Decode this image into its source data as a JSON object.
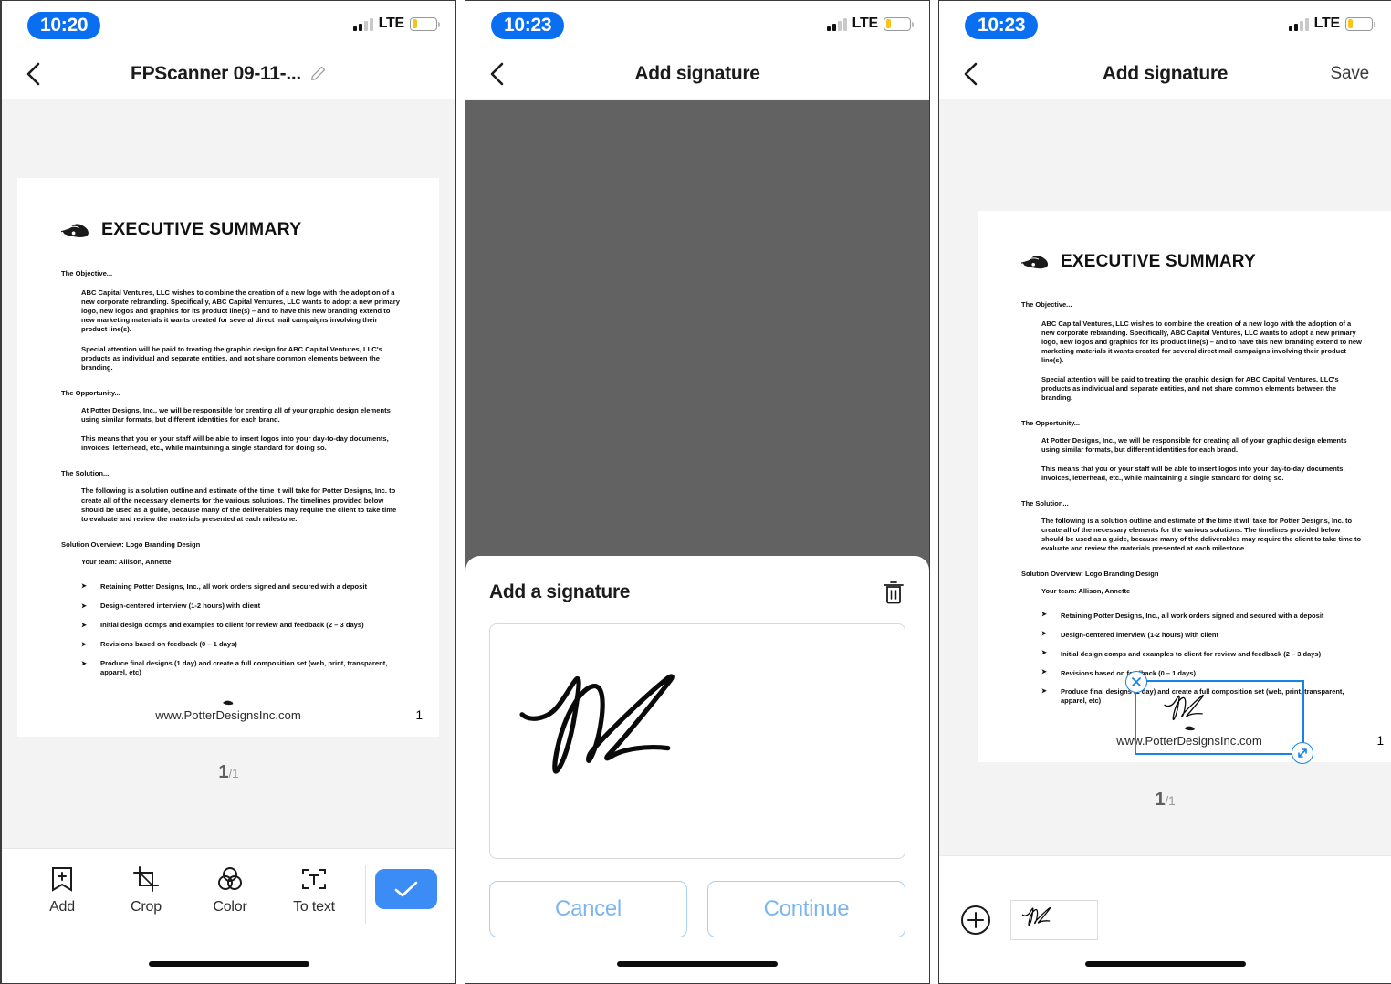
{
  "panels": [
    {
      "status": {
        "time": "10:20",
        "network": "LTE",
        "signal_bars": 2,
        "battery_pct": 22
      },
      "nav": {
        "back_icon": "chevron-left-icon",
        "title": "FPScanner 09-11-...",
        "edit_icon": "pencil-icon"
      },
      "page_indicator": {
        "current": "1",
        "total": "/1"
      },
      "toolbar": {
        "items": [
          {
            "label": "Add",
            "icon": "add-page-icon"
          },
          {
            "label": "Crop",
            "icon": "crop-icon"
          },
          {
            "label": "Color",
            "icon": "color-filter-icon"
          },
          {
            "label": "To text",
            "icon": "to-text-icon"
          }
        ],
        "confirm_icon": "checkmark-icon",
        "confirm_color": "#3b8cf4"
      }
    },
    {
      "status": {
        "time": "10:23",
        "network": "LTE",
        "signal_bars": 2,
        "battery_pct": 22
      },
      "nav": {
        "back_icon": "chevron-left-icon",
        "title": "Add signature"
      },
      "modal": {
        "title": "Add a signature",
        "delete_icon": "trash-icon",
        "canvas_placeholder": "",
        "cancel_label": "Cancel",
        "continue_label": "Continue",
        "accent_color": "#7db5ef"
      },
      "overlay_color": "#626262"
    },
    {
      "status": {
        "time": "10:23",
        "network": "LTE",
        "signal_bars": 2,
        "battery_pct": 22
      },
      "nav": {
        "back_icon": "chevron-left-icon",
        "title": "Add signature",
        "action_label": "Save"
      },
      "page_indicator": {
        "current": "1",
        "total": "/1"
      },
      "signature_box": {
        "close_icon": "close-icon",
        "resize_icon": "resize-diagonal-icon",
        "border_color": "#1a82e2"
      },
      "tray": {
        "add_icon": "plus-circle-icon",
        "thumb_name": "signature-thumbnail"
      }
    }
  ],
  "document": {
    "title": "EXECUTIVE SUMMARY",
    "logo": "potter-designs-logo",
    "sections": [
      {
        "heading": "The Objective...",
        "paragraphs": [
          "ABC Capital Ventures, LLC wishes to combine the creation of a new logo with the adoption of a new corporate rebranding. Specifically, ABC Capital Ventures, LLC wants to adopt a new primary logo, new logos and graphics for its product line(s) – and to have this new branding extend to new marketing materials it wants created for several direct mail campaigns involving their product line(s).",
          "Special attention will be paid to treating the graphic design for ABC Capital Ventures, LLC's products as individual and separate entities, and not share common elements between the branding."
        ]
      },
      {
        "heading": "The Opportunity...",
        "paragraphs": [
          "At Potter Designs, Inc., we will be responsible for creating all of your graphic design elements using similar formats, but different identities for each brand.",
          "This means that you or your staff will be able to insert logos into your day-to-day documents, invoices, letterhead, etc., while maintaining a single standard for doing so."
        ]
      },
      {
        "heading": "The Solution...",
        "paragraphs": [
          "The following is a solution outline and estimate of the time it will take for Potter Designs, Inc. to create all of the necessary elements for the various solutions. The timelines provided below should be used as a guide, because many of the deliverables may require the client to take time to evaluate and review the materials presented at each milestone."
        ]
      }
    ],
    "solution_overview": "Solution Overview: Logo Branding Design",
    "team_line": "Your team: Allison, Annette",
    "bullets": [
      "Retaining Potter Designs, Inc., all work orders signed and secured with a deposit",
      "Design-centered interview (1-2 hours) with client",
      "Initial design comps and examples to client for review and feedback (2 – 3 days)",
      "Revisions based on feedback (0 – 1 days)",
      "Produce final designs (1 day) and create a full composition set (web, print, transparent, apparel, etc)"
    ],
    "footer_url": "www.PotterDesignsInc.com",
    "footer_page": "1"
  }
}
